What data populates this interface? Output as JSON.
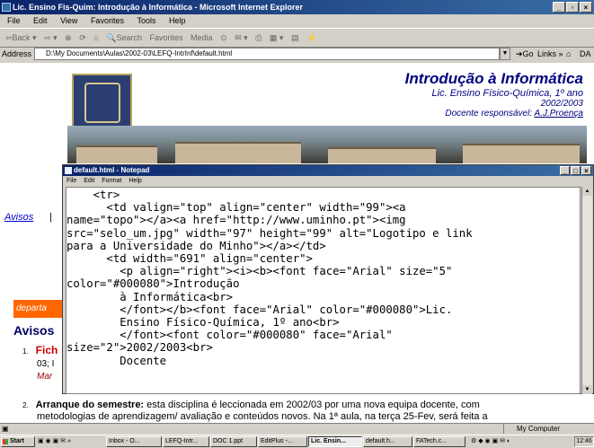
{
  "ie": {
    "title": "Lic. Ensino Fis-Quim: Introdução à Informática - Microsoft Internet Explorer",
    "menu": [
      "File",
      "Edit",
      "View",
      "Favorites",
      "Tools",
      "Help"
    ],
    "toolbar": [
      "⇦Back ▾",
      "⇨ ▾",
      "⊗",
      "⟳",
      "⌂",
      "🔍Search",
      "Favorites",
      "Media",
      "⊙",
      "✉ ▾",
      "⎙",
      "▦ ▾",
      "▤",
      "⚡"
    ],
    "address_label": "Address",
    "address_value": "D:\\My Documents\\Aulas\\2002-03\\LEFQ-IntrInf\\default.html",
    "go_label": "Go",
    "links_label": "Links »",
    "extra": "DA"
  },
  "page": {
    "title": "Introdução à Informática",
    "line2": "Lic. Ensino Físico-Química, 1º ano",
    "line3": "2002/2003",
    "docente_prefix": "Docente responsável: ",
    "docente_name": "A.J.Proença",
    "avisos_link": "Avisos",
    "depart_text": "departa",
    "avisos_heading": "Avisos",
    "item1_num": "1.",
    "item1_a": "Fich",
    "item1_b": "03; I",
    "item1_c": "Mar",
    "item2_num": "2.",
    "item2_bold": "Arranque do semestre:",
    "item2_text": " esta disciplina é leccionada em 2002/03 por uma nova equipa docente, com",
    "item2_line2": "metodologias de aprendizagem/ avaliação e conteúdos novos. Na 1ª aula, na terça 25-Fev, será feita a"
  },
  "notepad": {
    "title": "default.html - Notepad",
    "menu": [
      "File",
      "Edit",
      "Format",
      "Help"
    ],
    "lines": [
      "    <tr>",
      "      <td valign=\"top\" align=\"center\" width=\"99\"><a",
      "name=\"topo\"></a><a href=\"http://www.uminho.pt\"><img",
      "src=\"selo_um.jpg\" width=\"97\" height=\"99\" alt=\"Logotipo e link",
      "para a Universidade do Minho\"></a></td>",
      "      <td width=\"691\" align=\"center\">",
      "        <p align=\"right\"><i><b><font face=\"Arial\" size=\"5\"",
      "color=\"#000080\">Introdução",
      "        à Informática<br>",
      "        </font></b><font face=\"Arial\" color=\"#000080\">Lic.",
      "        Ensino Físico-Química, 1º ano<br>",
      "        </font><font color=\"#000080\" face=\"Arial\"",
      "size=\"2\">2002/2003<br>",
      "        Docente"
    ]
  },
  "status": {
    "left": "",
    "zone": "My Computer"
  },
  "taskbar": {
    "start": "Start",
    "tasks": [
      "Inbox - O...",
      "LEFQ-Intr...",
      "DOC 1.ppt",
      "EditPlus -...",
      "Lic. Ensin...",
      "default.h...",
      "FATech.c..."
    ],
    "clock": "12:46"
  },
  "colors": {
    "heading": "#000080",
    "depart": "#ff6600",
    "item_red": "#cc0000"
  }
}
